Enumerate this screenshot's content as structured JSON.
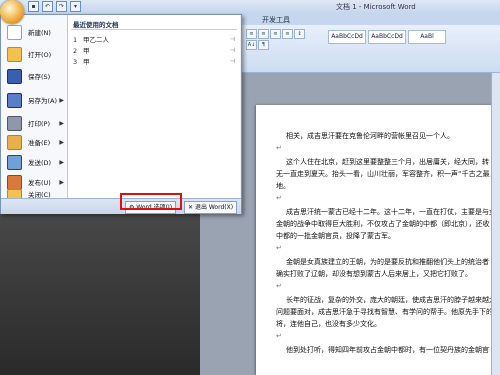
{
  "window": {
    "title": "文档 1 - Microsoft Word"
  },
  "ribbon_tabs": [
    {
      "label": "开发工具"
    }
  ],
  "ribbon": {
    "paragraph_group": [
      "≡",
      "≡",
      "≡",
      "≡",
      "↕",
      "A↓",
      "¶"
    ],
    "styles": [
      "AaBbCcDd",
      "AaBbCcDd",
      "AaBl"
    ]
  },
  "office_menu": {
    "items": [
      {
        "label": "新建(N)",
        "icon": "new-document-icon",
        "has_submenu": false
      },
      {
        "label": "打开(O)",
        "icon": "open-folder-icon",
        "has_submenu": false
      },
      {
        "label": "保存(S)",
        "icon": "save-disk-icon",
        "has_submenu": false
      },
      {
        "label": "另存为(A)",
        "icon": "save-as-icon",
        "has_submenu": true
      },
      {
        "label": "打印(P)",
        "icon": "printer-icon",
        "has_submenu": true
      },
      {
        "label": "准备(E)",
        "icon": "prepare-icon",
        "has_submenu": true
      },
      {
        "label": "发送(D)",
        "icon": "send-icon",
        "has_submenu": true
      },
      {
        "label": "发布(U)",
        "icon": "publish-icon",
        "has_submenu": true
      },
      {
        "label": "关闭(C)",
        "icon": "close-folder-icon",
        "has_submenu": false
      }
    ],
    "recent_title": "最近使用的文档",
    "recent_documents": [
      {
        "num": "1",
        "name": "甲乙二人"
      },
      {
        "num": "2",
        "name": "甲"
      },
      {
        "num": "3",
        "name": "甲"
      }
    ],
    "options_button": "Word 选项(I)",
    "exit_button": "退出 Word(X)"
  },
  "document": {
    "lines": [
      "相关，成吉思汗要在克鲁伦河畔的营帐里召见一个人。",
      "这个人住在北京，赶到这里要整整三个月，出居庸关，经大同，转",
      "无一直走到夏天。抬头一看，山川壮丽，军容整齐，积一声“千古之最，",
      "地。",
      "成吉思汗统一蒙古已经十二年。这十二年，一直在打仗，主要是与女",
      "金朝的战争中取得巨大胜利，不仅攻占了金朝的中都（即北京），还收",
      "中都的一批金朝官员，投降了蒙古军。",
      "金朝是女真族建立的王朝，为的是要反抗和推翻他们头上的统治者",
      "确实打败了辽朝，却没有想到蒙古人后来居上，又把它打败了。",
      "长年的征战，复杂的外交，庞大的朝廷，使成吉思汗的脖子越来越大",
      "问题要面对，成吉思汗急于寻找有智慧、有学问的帮手。他原先手下的",
      "将，连他自己，也没有多少文化。",
      "他到处打听，得知四年前攻占金朝中都时，有一位契丹族的金朝官"
    ]
  },
  "colors": {
    "highlight_box": "#dd1111",
    "menu_bg": "#eef2f8",
    "ribbon": "#cddcf1"
  }
}
